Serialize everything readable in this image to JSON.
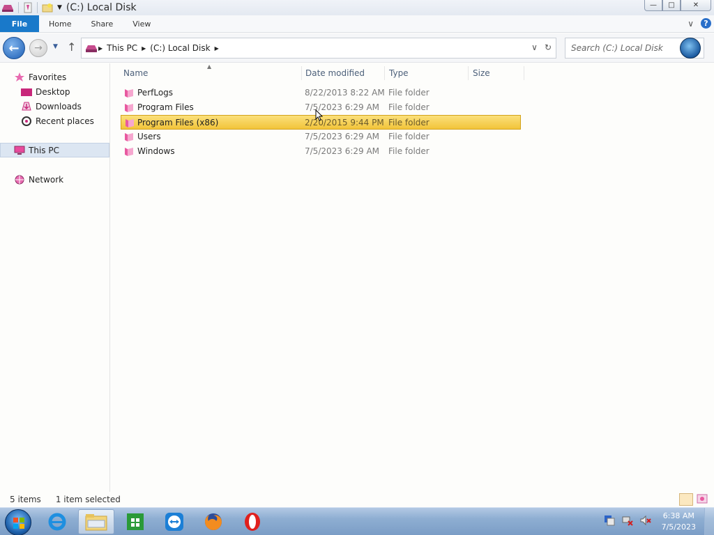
{
  "window": {
    "title": "(C:) Local Disk"
  },
  "window_controls": {
    "minimize": "—",
    "maximize": "□",
    "close": "✕"
  },
  "ribbon": {
    "tabs": [
      "File",
      "Home",
      "Share",
      "View"
    ],
    "expand_icon": "∨",
    "help": "?"
  },
  "address": {
    "breadcrumbs": [
      "This PC",
      "(C:) Local Disk"
    ],
    "dropdown_icon": "∨",
    "refresh_icon": "↻"
  },
  "search": {
    "placeholder": "Search (C:) Local Disk"
  },
  "navigation": {
    "favorites_label": "Favorites",
    "favorites": [
      "Desktop",
      "Downloads",
      "Recent places"
    ],
    "this_pc": "This PC",
    "network": "Network"
  },
  "columns": {
    "name": "Name",
    "date_modified": "Date modified",
    "type": "Type",
    "size": "Size"
  },
  "files": [
    {
      "name": "PerfLogs",
      "date": "8/22/2013 8:22 AM",
      "type": "File folder",
      "size": ""
    },
    {
      "name": "Program Files",
      "date": "7/5/2023 6:29 AM",
      "type": "File folder",
      "size": ""
    },
    {
      "name": "Program Files (x86)",
      "date": "2/20/2015 9:44 PM",
      "type": "File folder",
      "size": "",
      "selected": true
    },
    {
      "name": "Users",
      "date": "7/5/2023 6:29 AM",
      "type": "File folder",
      "size": ""
    },
    {
      "name": "Windows",
      "date": "7/5/2023 6:29 AM",
      "type": "File folder",
      "size": ""
    }
  ],
  "status": {
    "item_count": "5 items",
    "selection": "1 item selected"
  },
  "taskbar": {
    "apps": [
      "internet-explorer",
      "file-explorer",
      "store",
      "teamviewer",
      "firefox",
      "opera"
    ],
    "clock_time": "6:38 AM",
    "clock_date": "7/5/2023"
  },
  "colors": {
    "accent": "#1979ca",
    "selection": "#f4c842",
    "folder": "#e85aa0"
  }
}
